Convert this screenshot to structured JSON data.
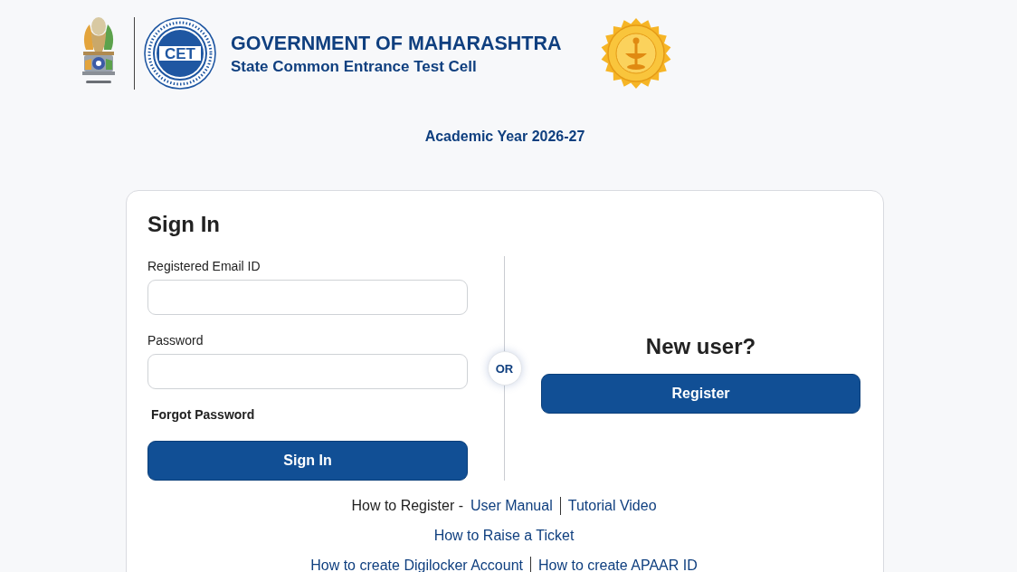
{
  "header": {
    "cet_logo": {
      "text": "CET"
    },
    "title": "GOVERNMENT OF MAHARASHTRA",
    "subtitle": "State Common Entrance Test Cell"
  },
  "academic_year": "Academic Year 2026-27",
  "sign_in": {
    "heading": "Sign In",
    "fields": [
      {
        "label": "Registered Email ID"
      },
      {
        "label": "Password"
      }
    ],
    "forgot_link": "Forgot Password",
    "button": "Sign In"
  },
  "divider": {
    "label": "OR"
  },
  "register": {
    "heading": "New user?",
    "button": "Register"
  },
  "help_links": [
    {
      "lead": "How to Register -",
      "links": [
        "User Manual",
        "Tutorial Video"
      ]
    },
    {
      "links": [
        "How to Raise a Ticket"
      ]
    },
    {
      "links": [
        "How to create Digilocker Account",
        "How to create APAAR ID"
      ]
    }
  ]
}
